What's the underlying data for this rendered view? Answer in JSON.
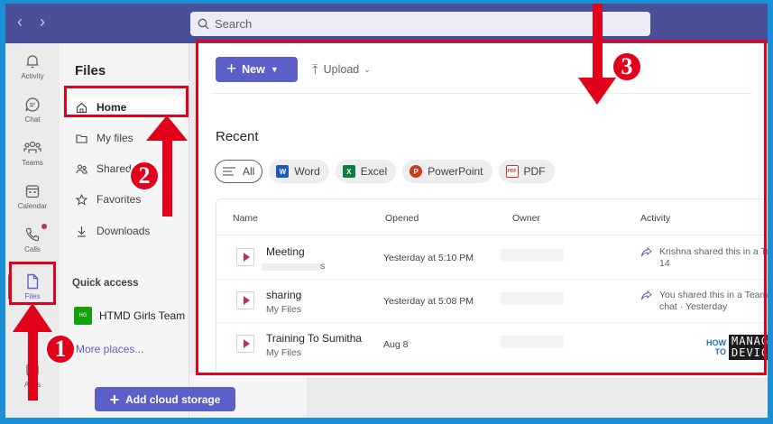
{
  "search": {
    "placeholder": "Search"
  },
  "rail": {
    "items": [
      {
        "label": "Activity"
      },
      {
        "label": "Chat"
      },
      {
        "label": "Teams"
      },
      {
        "label": "Calendar"
      },
      {
        "label": "Calls"
      },
      {
        "label": "Files"
      },
      {
        "label": "Apps"
      }
    ]
  },
  "panel": {
    "title": "Files",
    "items": [
      {
        "label": "Home"
      },
      {
        "label": "My files"
      },
      {
        "label": "Shared"
      },
      {
        "label": "Favorites"
      },
      {
        "label": "Downloads"
      }
    ],
    "quick_access": "Quick access",
    "team": {
      "tile": "HG",
      "label": "HTMD Girls Team"
    },
    "more_places": "More places...",
    "add_cloud": "Add cloud storage"
  },
  "main": {
    "new_label": "New",
    "upload_label": "Upload",
    "recent_title": "Recent",
    "chips": [
      {
        "label": "All"
      },
      {
        "label": "Word",
        "icon": "W"
      },
      {
        "label": "Excel",
        "icon": "X"
      },
      {
        "label": "PowerPoint",
        "icon": "P"
      },
      {
        "label": "PDF",
        "icon": "PDF"
      }
    ],
    "columns": [
      "Name",
      "Opened",
      "Owner",
      "Activity"
    ],
    "rows": [
      {
        "name": "Meeting",
        "location": "s",
        "opened": "Yesterday at 5:10 PM",
        "activity1": "Krishna shared this in a Te",
        "activity2": "14"
      },
      {
        "name": "sharing",
        "location": "My Files",
        "opened": "Yesterday at 5:08 PM",
        "activity1": "You shared this in a Teams",
        "activity2": "chat · Yesterday"
      },
      {
        "name": "Training To Sumitha",
        "location": "My Files",
        "opened": "Aug 8",
        "activity1": "",
        "activity2": ""
      }
    ]
  },
  "annotations": {
    "n1": "1",
    "n2": "2",
    "n3": "3"
  },
  "logo": {
    "how": "HOW",
    "to": "TO",
    "line1": "MANAGE",
    "line2": "DEVICES"
  },
  "colors": {
    "accent": "#5b5fc7",
    "titlebar": "#4a4f99",
    "annotation": "#e3001b"
  }
}
